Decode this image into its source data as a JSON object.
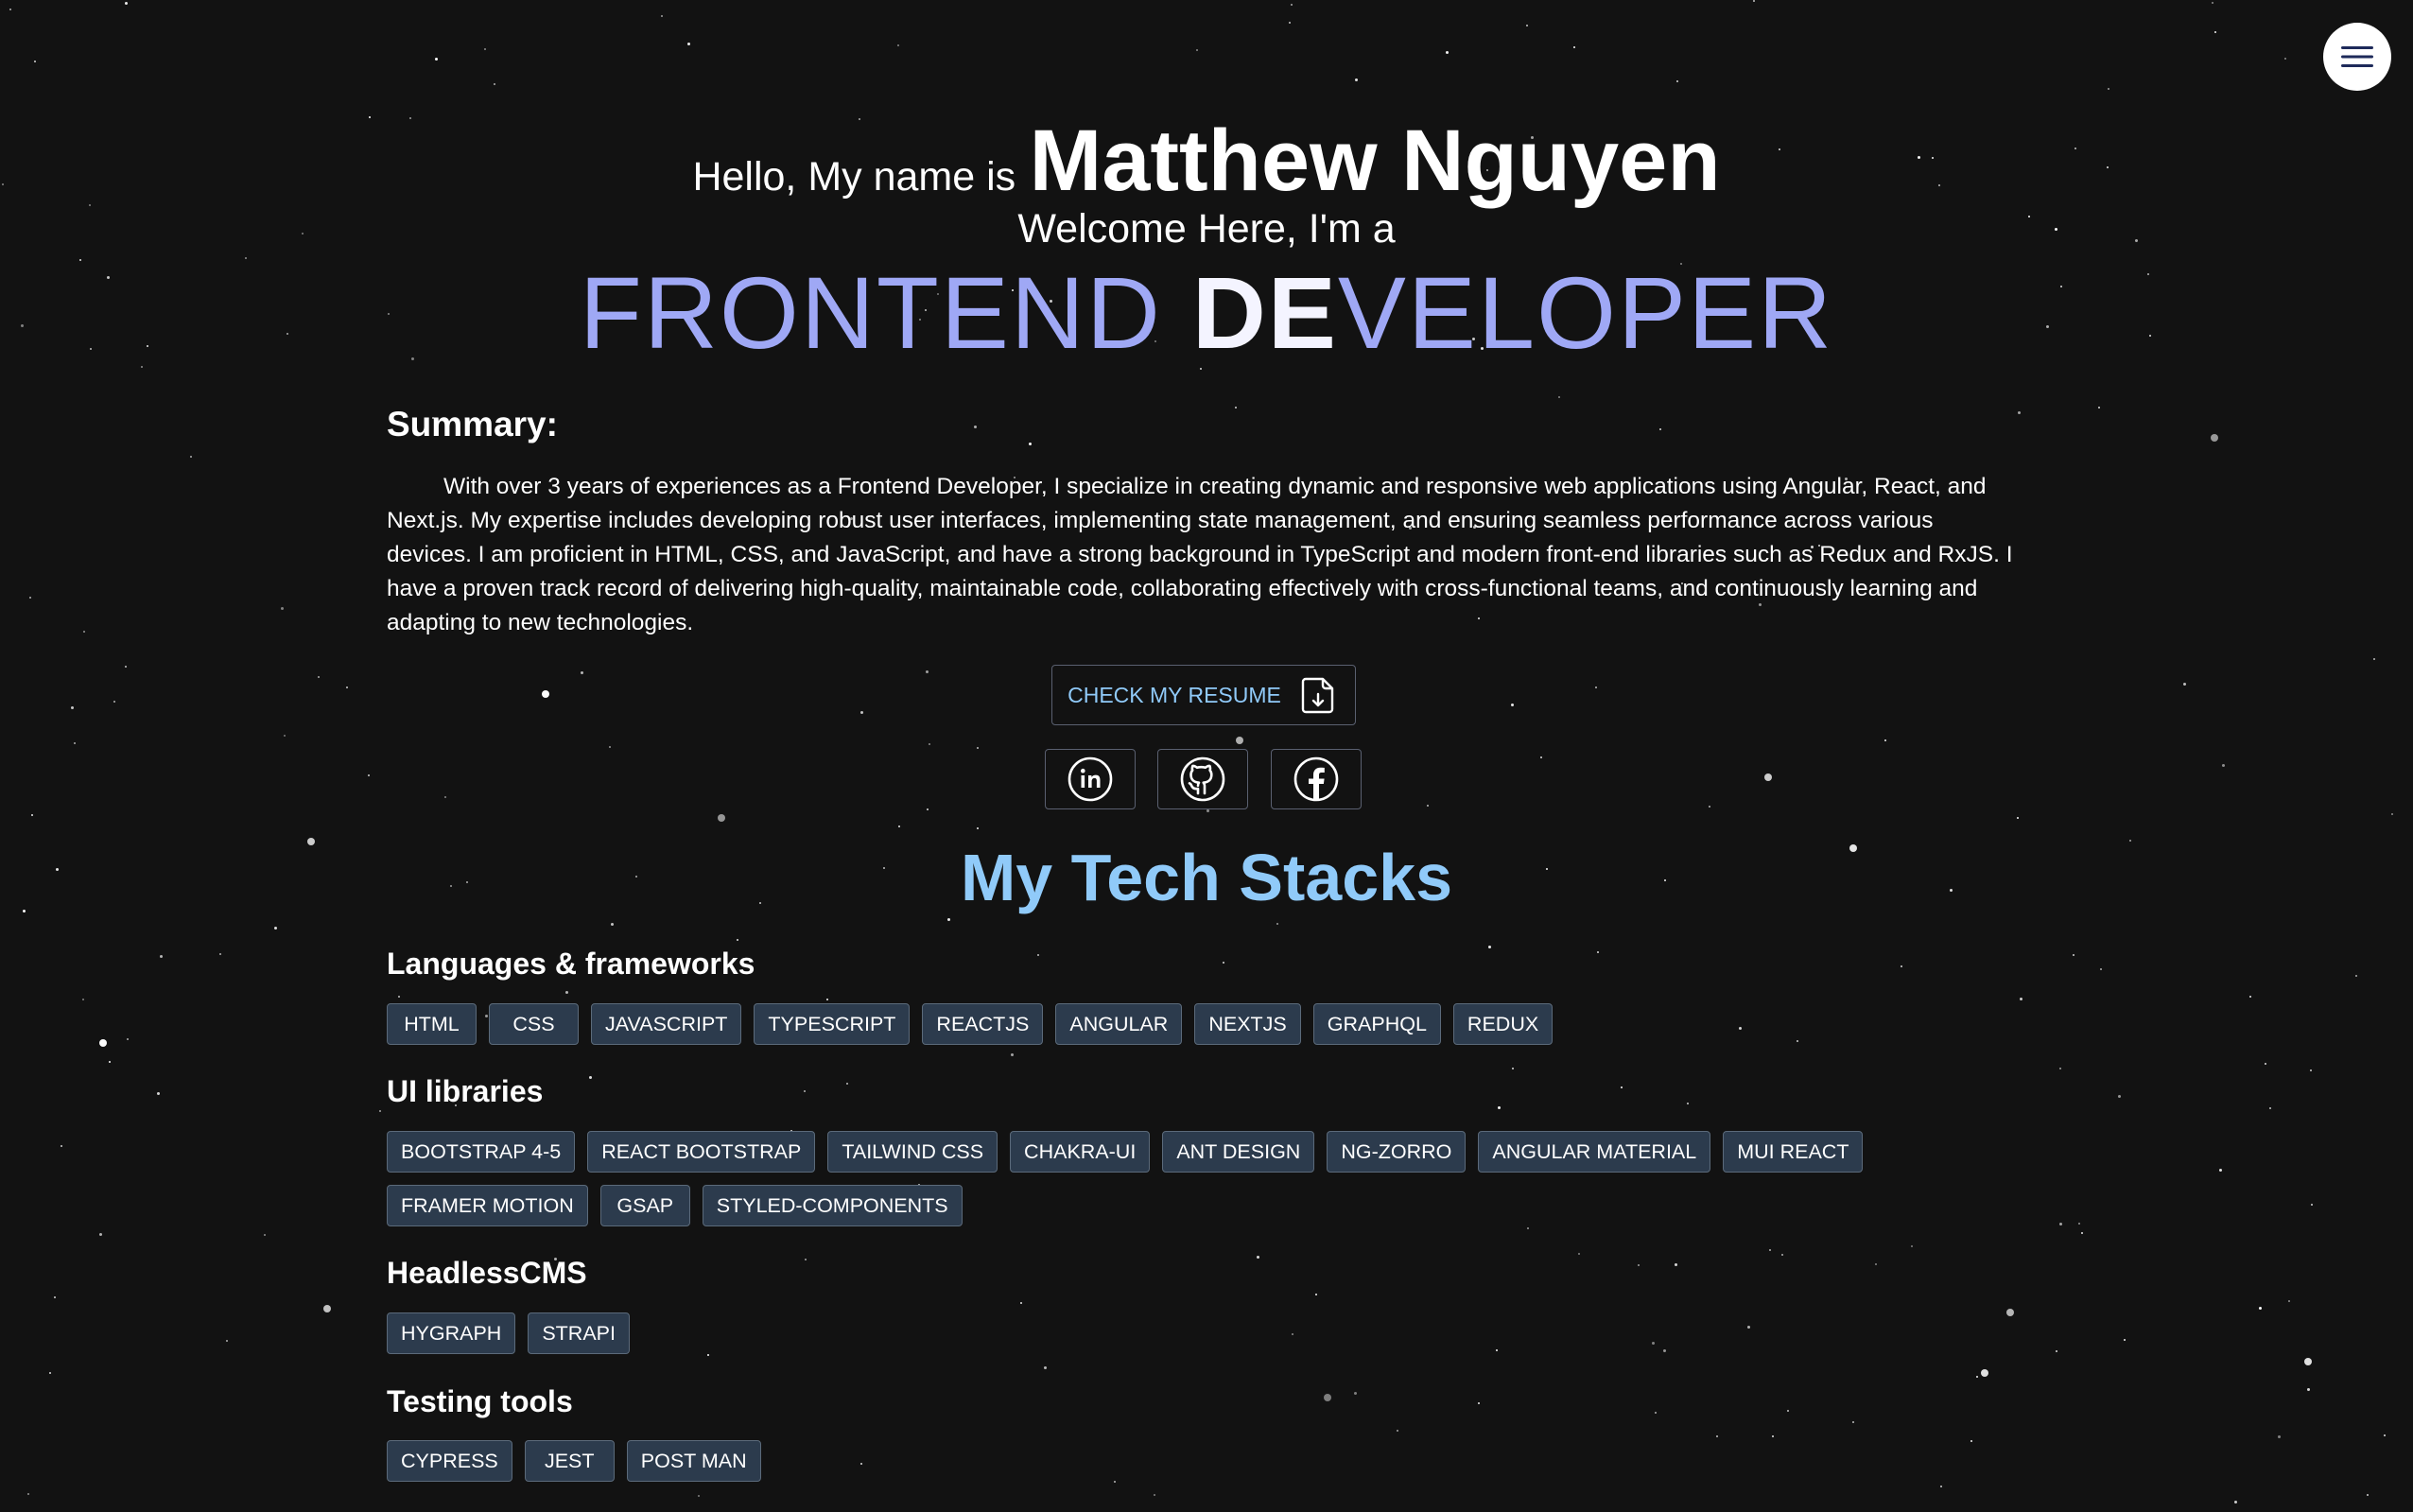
{
  "header": {
    "menu_icon": "hamburger-menu-icon"
  },
  "hero": {
    "greeting": "Hello, My name is",
    "name": "Matthew Nguyen",
    "welcome": "Welcome Here, I'm a",
    "role_part1": "FRONTEND ",
    "role_highlight": "DE",
    "role_part2": "VELOPER"
  },
  "summary": {
    "title": "Summary:",
    "text": "With over 3 years of experiences as a Frontend Developer, I specialize in creating dynamic and responsive web applications using Angular, React, and Next.js. My expertise includes developing robust user interfaces, implementing state management, and ensuring seamless performance across various devices. I am proficient in HTML, CSS, and JavaScript, and have a strong background in TypeScript and modern front-end libraries such as Redux and RxJS. I have a proven track record of delivering high-quality, maintainable code, collaborating effectively with cross-functional teams, and continuously learning and adapting to new technologies."
  },
  "resume_button": {
    "label": "CHECK MY RESUME",
    "icon": "file-download-icon"
  },
  "socials": [
    {
      "name": "LinkedIn",
      "icon": "linkedin-icon"
    },
    {
      "name": "GitHub",
      "icon": "github-icon"
    },
    {
      "name": "Facebook",
      "icon": "facebook-icon"
    }
  ],
  "tech_stacks": {
    "title": "My Tech Stacks",
    "groups": [
      {
        "title": "Languages & frameworks",
        "items": [
          "HTML",
          "CSS",
          "JAVASCRIPT",
          "TYPESCRIPT",
          "REACTJS",
          "ANGULAR",
          "NEXTJS",
          "GRAPHQL",
          "REDUX"
        ]
      },
      {
        "title": "UI libraries",
        "items": [
          "BOOTSTRAP 4-5",
          "REACT BOOTSTRAP",
          "TAILWIND CSS",
          "CHAKRA-UI",
          "ANT DESIGN",
          "NG-ZORRO",
          "ANGULAR MATERIAL",
          "MUI REACT",
          "FRAMER MOTION",
          "GSAP",
          "STYLED-COMPONENTS"
        ]
      },
      {
        "title": "HeadlessCMS",
        "items": [
          "HYGRAPH",
          "STRAPI"
        ]
      },
      {
        "title": "Testing tools",
        "items": [
          "CYPRESS",
          "JEST",
          "POST MAN"
        ]
      }
    ]
  },
  "colors": {
    "background": "#121212",
    "accent_blue": "#90caf9",
    "role_purple": "#9fa8f5",
    "chip_bg": "#2c3b4d"
  }
}
